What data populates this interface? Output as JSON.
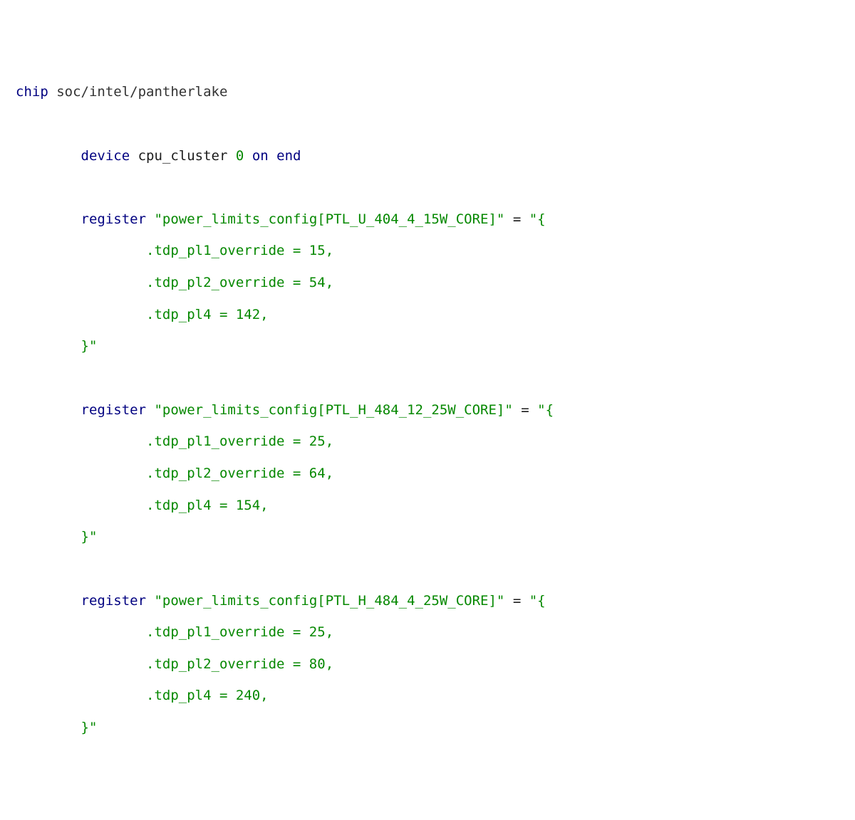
{
  "kw": {
    "chip": "chip",
    "device": "device",
    "on": "on",
    "end": "end",
    "register": "register"
  },
  "chip_path": "soc/intel/pantherlake",
  "device_name": "cpu_cluster",
  "device_idx": "0",
  "blocks": [
    {
      "key": "\"power_limits_config[PTL_U_404_4_15W_CORE]\"",
      "fields": [
        ".tdp_pl1_override = 15,",
        ".tdp_pl2_override = 54,",
        ".tdp_pl4 = 142,"
      ]
    },
    {
      "key": "\"power_limits_config[PTL_H_484_12_25W_CORE]\"",
      "fields": [
        ".tdp_pl1_override = 25,",
        ".tdp_pl2_override = 64,",
        ".tdp_pl4 = 154,"
      ]
    },
    {
      "key": "\"power_limits_config[PTL_H_484_4_25W_CORE]\"",
      "fields": [
        ".tdp_pl1_override = 25,",
        ".tdp_pl2_override = 80,",
        ".tdp_pl4 = 240,"
      ]
    }
  ],
  "eq": " = ",
  "open": "\"{",
  "close": "}\""
}
